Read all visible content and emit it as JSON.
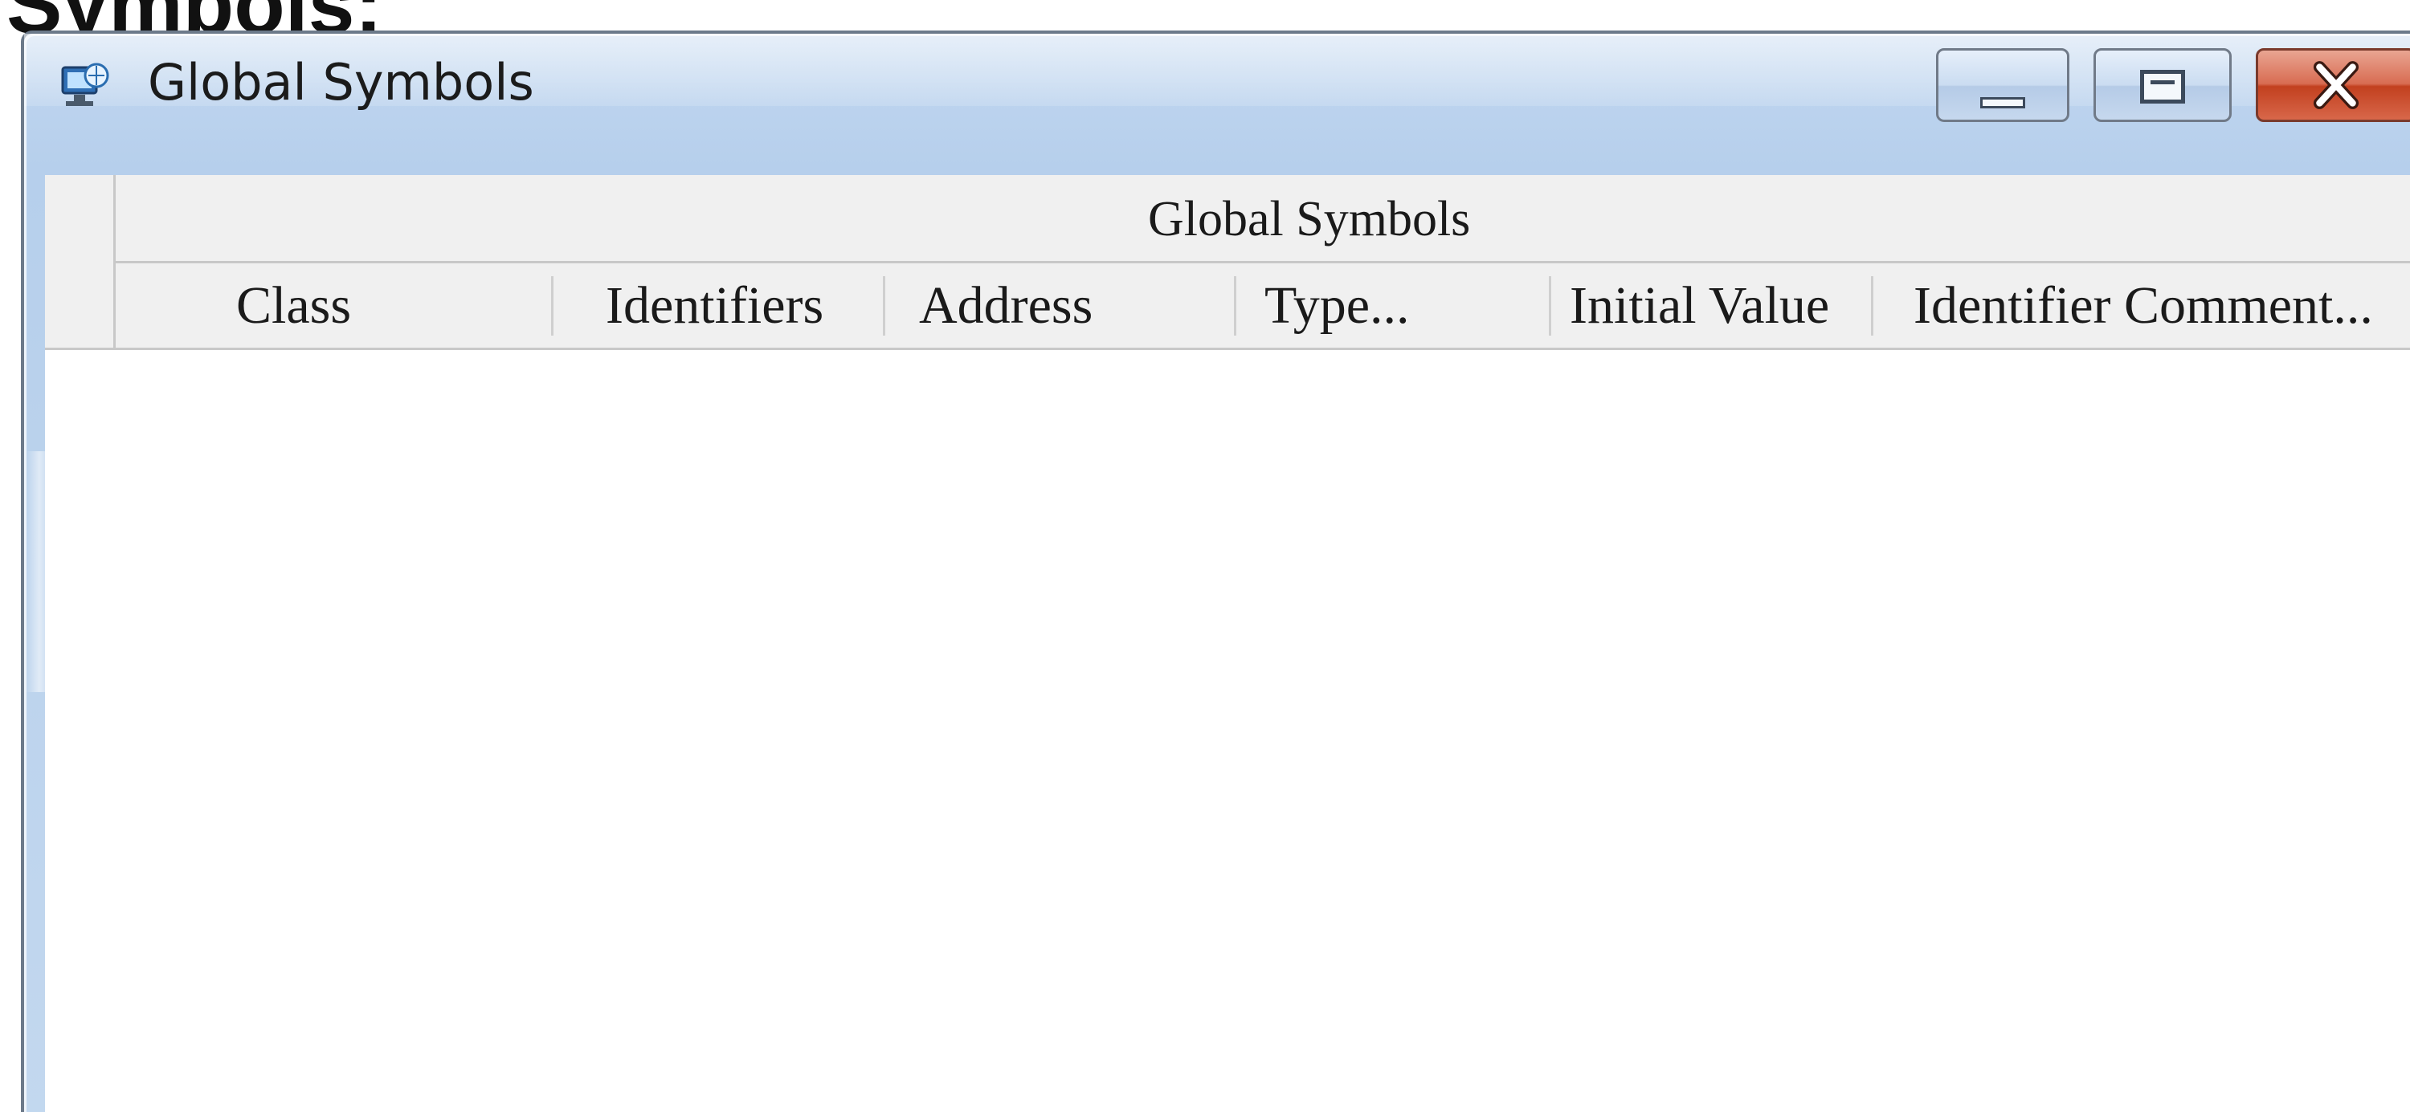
{
  "page_heading": "Symbols:",
  "window": {
    "title": "Global Symbols",
    "icon": "global-symbols-window-icon"
  },
  "caption_buttons": {
    "minimize_icon": "minimize-icon",
    "maximize_icon": "maximize-icon",
    "close_icon": "close-icon"
  },
  "table": {
    "group_header": "Global Symbols",
    "columns": [
      "Class",
      "Identifiers",
      "Address",
      "Type...",
      "Initial Value",
      "Identifier Comment..."
    ],
    "rows": []
  },
  "colors": {
    "title_bar": "#b9d1ec",
    "close_button": "#c94b2d",
    "header_background": "#f0f0f0"
  }
}
